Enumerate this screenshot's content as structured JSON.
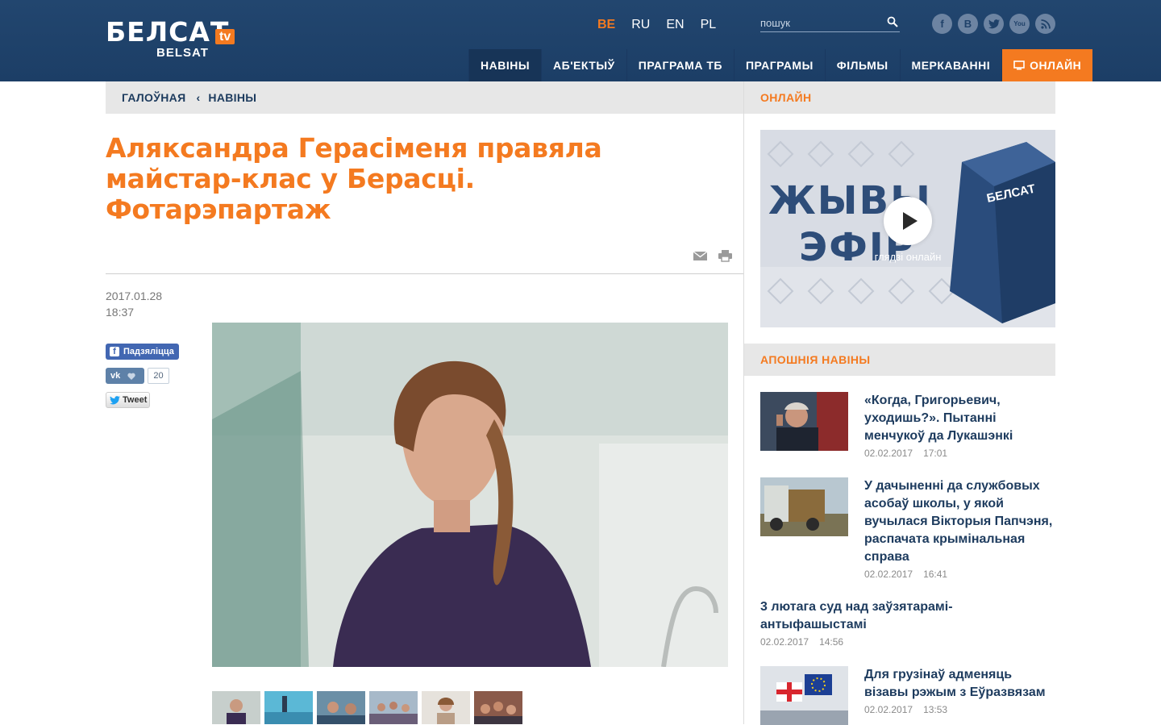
{
  "header": {
    "logo_main": "БЕЛСАТ",
    "logo_tv": "tv",
    "logo_sub": "BELSAT",
    "languages": [
      "BE",
      "RU",
      "EN",
      "PL"
    ],
    "active_language": "BE",
    "search_placeholder": "пошук",
    "socials": [
      "facebook-icon",
      "vkontakte-icon",
      "twitter-icon",
      "youtube-icon",
      "rss-icon"
    ],
    "nav": [
      {
        "label": "НАВІНЫ"
      },
      {
        "label": "АБ'ЕКТЫЎ"
      },
      {
        "label": "ПРАГРАМА ТБ"
      },
      {
        "label": "ПРАГРАМЫ"
      },
      {
        "label": "ФІЛЬМЫ"
      },
      {
        "label": "МЕРКАВАННІ"
      },
      {
        "label": "ОНЛАЙН"
      }
    ]
  },
  "breadcrumb": {
    "home": "ГАЛОЎНАЯ",
    "current": "НАВІНЫ"
  },
  "article": {
    "title": "Аляксандра Герасіменя правяла майстар-клас у Берасці. Фотарэпартаж",
    "date": "2017.01.28",
    "time": "18:37",
    "share": {
      "facebook": "Падзяліцца",
      "vk_count": "20",
      "twitter": "Tweet"
    }
  },
  "sidebar": {
    "online_heading": "ОНЛАЙН",
    "live_text_1": "ЖЫВЫ",
    "live_text_2": "ЭФІР",
    "live_label": "глядзі онлайн",
    "latest_heading": "АПОШНІЯ НАВІНЫ",
    "news": [
      {
        "title": "«Когда, Григорьевич, уходишь?». Пытанні менчукоў да Лукашэнкі",
        "date": "02.02.2017",
        "time": "17:01"
      },
      {
        "title": "У дачыненні да службовых асобаў школы, у якой вучылася Вікторыя Папчэня, распачата крымінальная справа",
        "date": "02.02.2017",
        "time": "16:41"
      },
      {
        "title": "3 лютага суд над заўзятарамі-антыфашыстамі",
        "date": "02.02.2017",
        "time": "14:56"
      },
      {
        "title": "Для грузінаў адменяць візавы рэжым з Еўразвязам",
        "date": "02.02.2017",
        "time": "13:53"
      }
    ]
  },
  "colors": {
    "brand_blue": "#1f4169",
    "accent_orange": "#f47a20"
  }
}
